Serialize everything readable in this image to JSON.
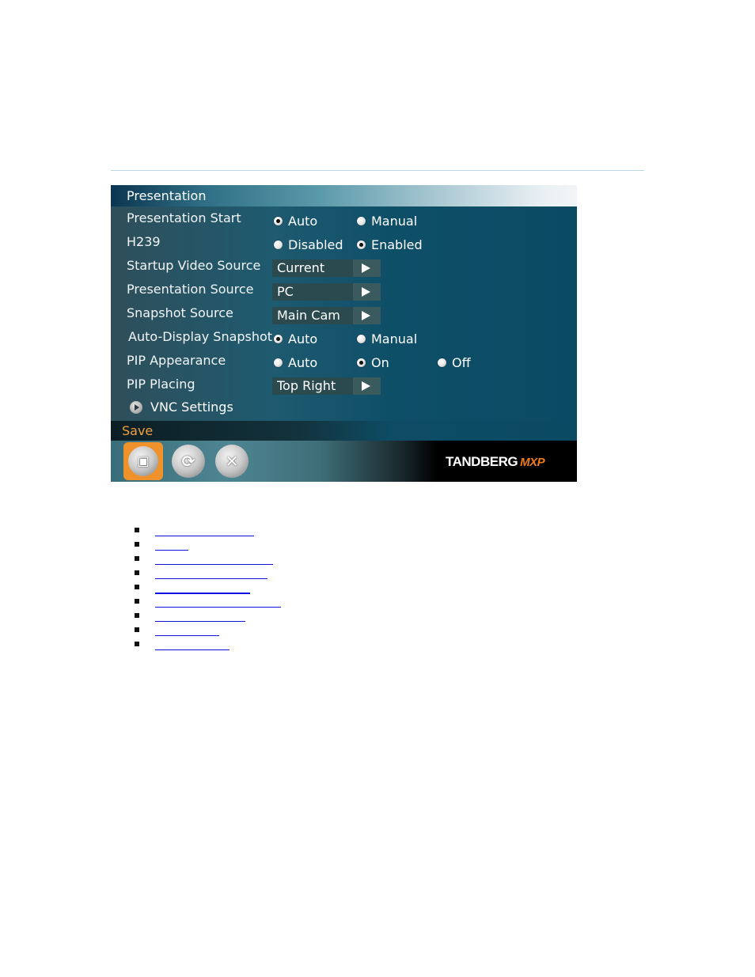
{
  "panel": {
    "title": "Presentation",
    "rows": [
      {
        "label": "Presentation Start",
        "type": "radio",
        "options": [
          "Auto",
          "Manual"
        ],
        "selected": "Auto"
      },
      {
        "label": "H239",
        "type": "radio",
        "options": [
          "Disabled",
          "Enabled"
        ],
        "selected": "Enabled"
      },
      {
        "label": "Startup Video Source",
        "type": "select",
        "value": "Current"
      },
      {
        "label": "Presentation Source",
        "type": "select",
        "value": "PC"
      },
      {
        "label": "Snapshot Source",
        "type": "select",
        "value": "Main Cam"
      },
      {
        "label": "Auto-Display Snapshot",
        "type": "radio",
        "options": [
          "Auto",
          "Manual"
        ],
        "selected": "Auto"
      },
      {
        "label": "PIP Appearance",
        "type": "radio",
        "options": [
          "Auto",
          "On",
          "Off"
        ],
        "selected": "On"
      },
      {
        "label": "PIP Placing",
        "type": "select",
        "value": "Top Right"
      }
    ],
    "vnc_settings": "VNC Settings",
    "save_label": "Save",
    "toolbar": {
      "buttons": [
        {
          "name": "save",
          "icon": "floppy-disk-icon",
          "glyph": "💾",
          "selected": true
        },
        {
          "name": "refresh",
          "icon": "refresh-icon",
          "glyph": "⟳",
          "selected": false
        },
        {
          "name": "cancel",
          "icon": "close-icon",
          "glyph": "✕",
          "selected": false
        }
      ]
    },
    "brand": "TANDBERG",
    "brand_suffix": "MXP",
    "colors": {
      "accent": "#f0922c",
      "save_text": "#f0a040",
      "link": "#1010e0"
    }
  },
  "links": [
    "",
    "",
    "",
    "",
    "",
    "",
    "",
    "",
    ""
  ]
}
